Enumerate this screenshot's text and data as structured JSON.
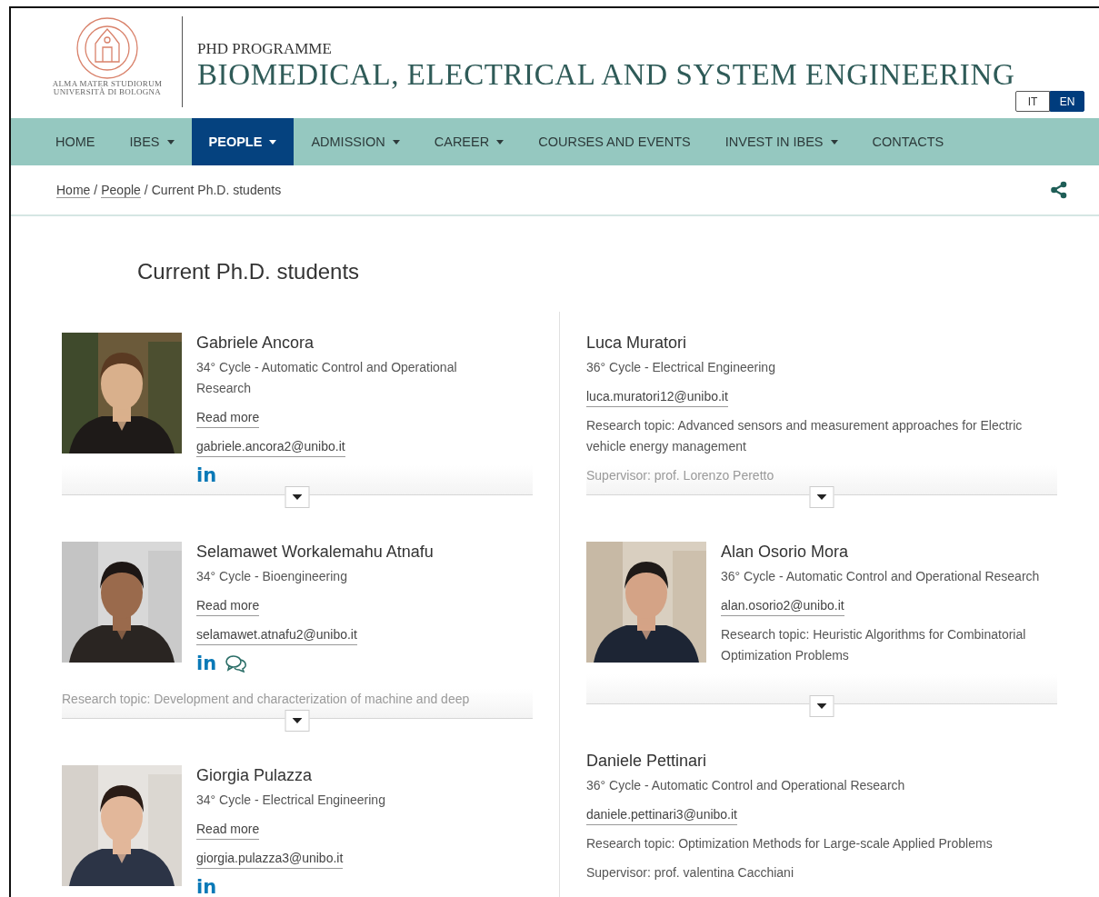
{
  "header": {
    "university": [
      "ALMA MATER STUDIORUM",
      "UNIVERSITÀ DI BOLOGNA"
    ],
    "programme_label": "PHD PROGRAMME",
    "programme_title": "BIOMEDICAL, ELECTRICAL AND SYSTEM ENGINEERING",
    "languages": [
      {
        "label": "IT",
        "selected": false
      },
      {
        "label": "EN",
        "selected": true
      }
    ]
  },
  "nav": [
    {
      "label": "HOME",
      "dropdown": false,
      "selected": false
    },
    {
      "label": "IBES",
      "dropdown": true,
      "selected": false
    },
    {
      "label": "PEOPLE",
      "dropdown": true,
      "selected": true
    },
    {
      "label": "ADMISSION",
      "dropdown": true,
      "selected": false
    },
    {
      "label": "CAREER",
      "dropdown": true,
      "selected": false
    },
    {
      "label": "COURSES AND EVENTS",
      "dropdown": false,
      "selected": false
    },
    {
      "label": "INVEST IN IBES",
      "dropdown": true,
      "selected": false
    },
    {
      "label": "CONTACTS",
      "dropdown": false,
      "selected": false
    }
  ],
  "breadcrumb": [
    {
      "kind": "link",
      "text": "Home"
    },
    {
      "kind": "separator",
      "text": "/"
    },
    {
      "kind": "link",
      "text": "People"
    },
    {
      "kind": "separator",
      "text": "/"
    },
    {
      "kind": "current",
      "text": "Current Ph.D. students"
    }
  ],
  "page_title": "Current Ph.D. students",
  "columns": [
    [
      {
        "name": "Gabriele Ancora",
        "collapsible": true,
        "photo": {
          "kind": "picture"
        },
        "lines": [
          {
            "kind": "text",
            "text": "34° Cycle - Automatic Control and Operational Research",
            "faded": false
          },
          {
            "kind": "link",
            "text": "Read more",
            "faded": false
          },
          {
            "kind": "link",
            "text": "gabriele.ancora2@unibo.it",
            "faded": false
          },
          {
            "kind": "social",
            "links": [
              {
                "kind": "linkedin",
                "text": "in"
              }
            ]
          }
        ]
      },
      {
        "name": "Selamawet Workalemahu Atnafu",
        "collapsible": true,
        "photo": {
          "kind": "picture"
        },
        "lines": [
          {
            "kind": "text",
            "text": "34° Cycle - Bioengineering",
            "faded": false
          },
          {
            "kind": "link",
            "text": "Read more",
            "faded": false
          },
          {
            "kind": "link",
            "text": "selamawet.atnafu2@unibo.it",
            "faded": false
          },
          {
            "kind": "social",
            "links": [
              {
                "kind": "linkedin",
                "text": "in"
              },
              {
                "kind": "chat"
              }
            ]
          },
          {
            "kind": "wide_text",
            "text": "Research topic: Development and characterization of machine and deep",
            "faded": true
          }
        ]
      },
      {
        "name": "Giorgia Pulazza",
        "photo": {
          "kind": "picture"
        },
        "lines": [
          {
            "kind": "text",
            "text": "34° Cycle - Electrical Engineering",
            "faded": false
          },
          {
            "kind": "link",
            "text": "Read more",
            "faded": false
          },
          {
            "kind": "link",
            "text": "giorgia.pulazza3@unibo.it",
            "faded": false
          },
          {
            "kind": "social",
            "links": [
              {
                "kind": "linkedin",
                "text": "in"
              }
            ]
          }
        ]
      }
    ],
    [
      {
        "name": "Luca Muratori",
        "collapsible": true,
        "lines": [
          {
            "kind": "text",
            "text": "36° Cycle - Electrical Engineering",
            "faded": false
          },
          {
            "kind": "link",
            "text": "luca.muratori12@unibo.it",
            "faded": false
          },
          {
            "kind": "text",
            "text": "Research topic: Advanced sensors and measurement approaches for Electric vehicle energy management",
            "faded": false
          },
          {
            "kind": "text",
            "text": "Supervisor: prof. Lorenzo Peretto",
            "faded": true
          }
        ]
      },
      {
        "name": "Alan Osorio Mora",
        "collapsible": true,
        "photo": {
          "kind": "picture"
        },
        "lines": [
          {
            "kind": "text",
            "text": "36° Cycle - Automatic Control and Operational Research",
            "faded": false
          },
          {
            "kind": "link",
            "text": "alan.osorio2@unibo.it",
            "faded": false
          },
          {
            "kind": "text",
            "text": "Research topic: Heuristic Algorithms for Combinatorial Optimization Problems",
            "faded": false
          }
        ]
      },
      {
        "name": "Daniele Pettinari",
        "lines": [
          {
            "kind": "text",
            "text": "36° Cycle - Automatic Control and Operational Research",
            "faded": false
          },
          {
            "kind": "link",
            "text": "daniele.pettinari3@unibo.it",
            "faded": false
          },
          {
            "kind": "text",
            "text": "Research topic: Optimization Methods for Large-scale Applied Problems",
            "faded": false
          },
          {
            "kind": "text",
            "text": "Supervisor: prof. valentina Cacchiani",
            "faded": false
          }
        ]
      }
    ]
  ]
}
